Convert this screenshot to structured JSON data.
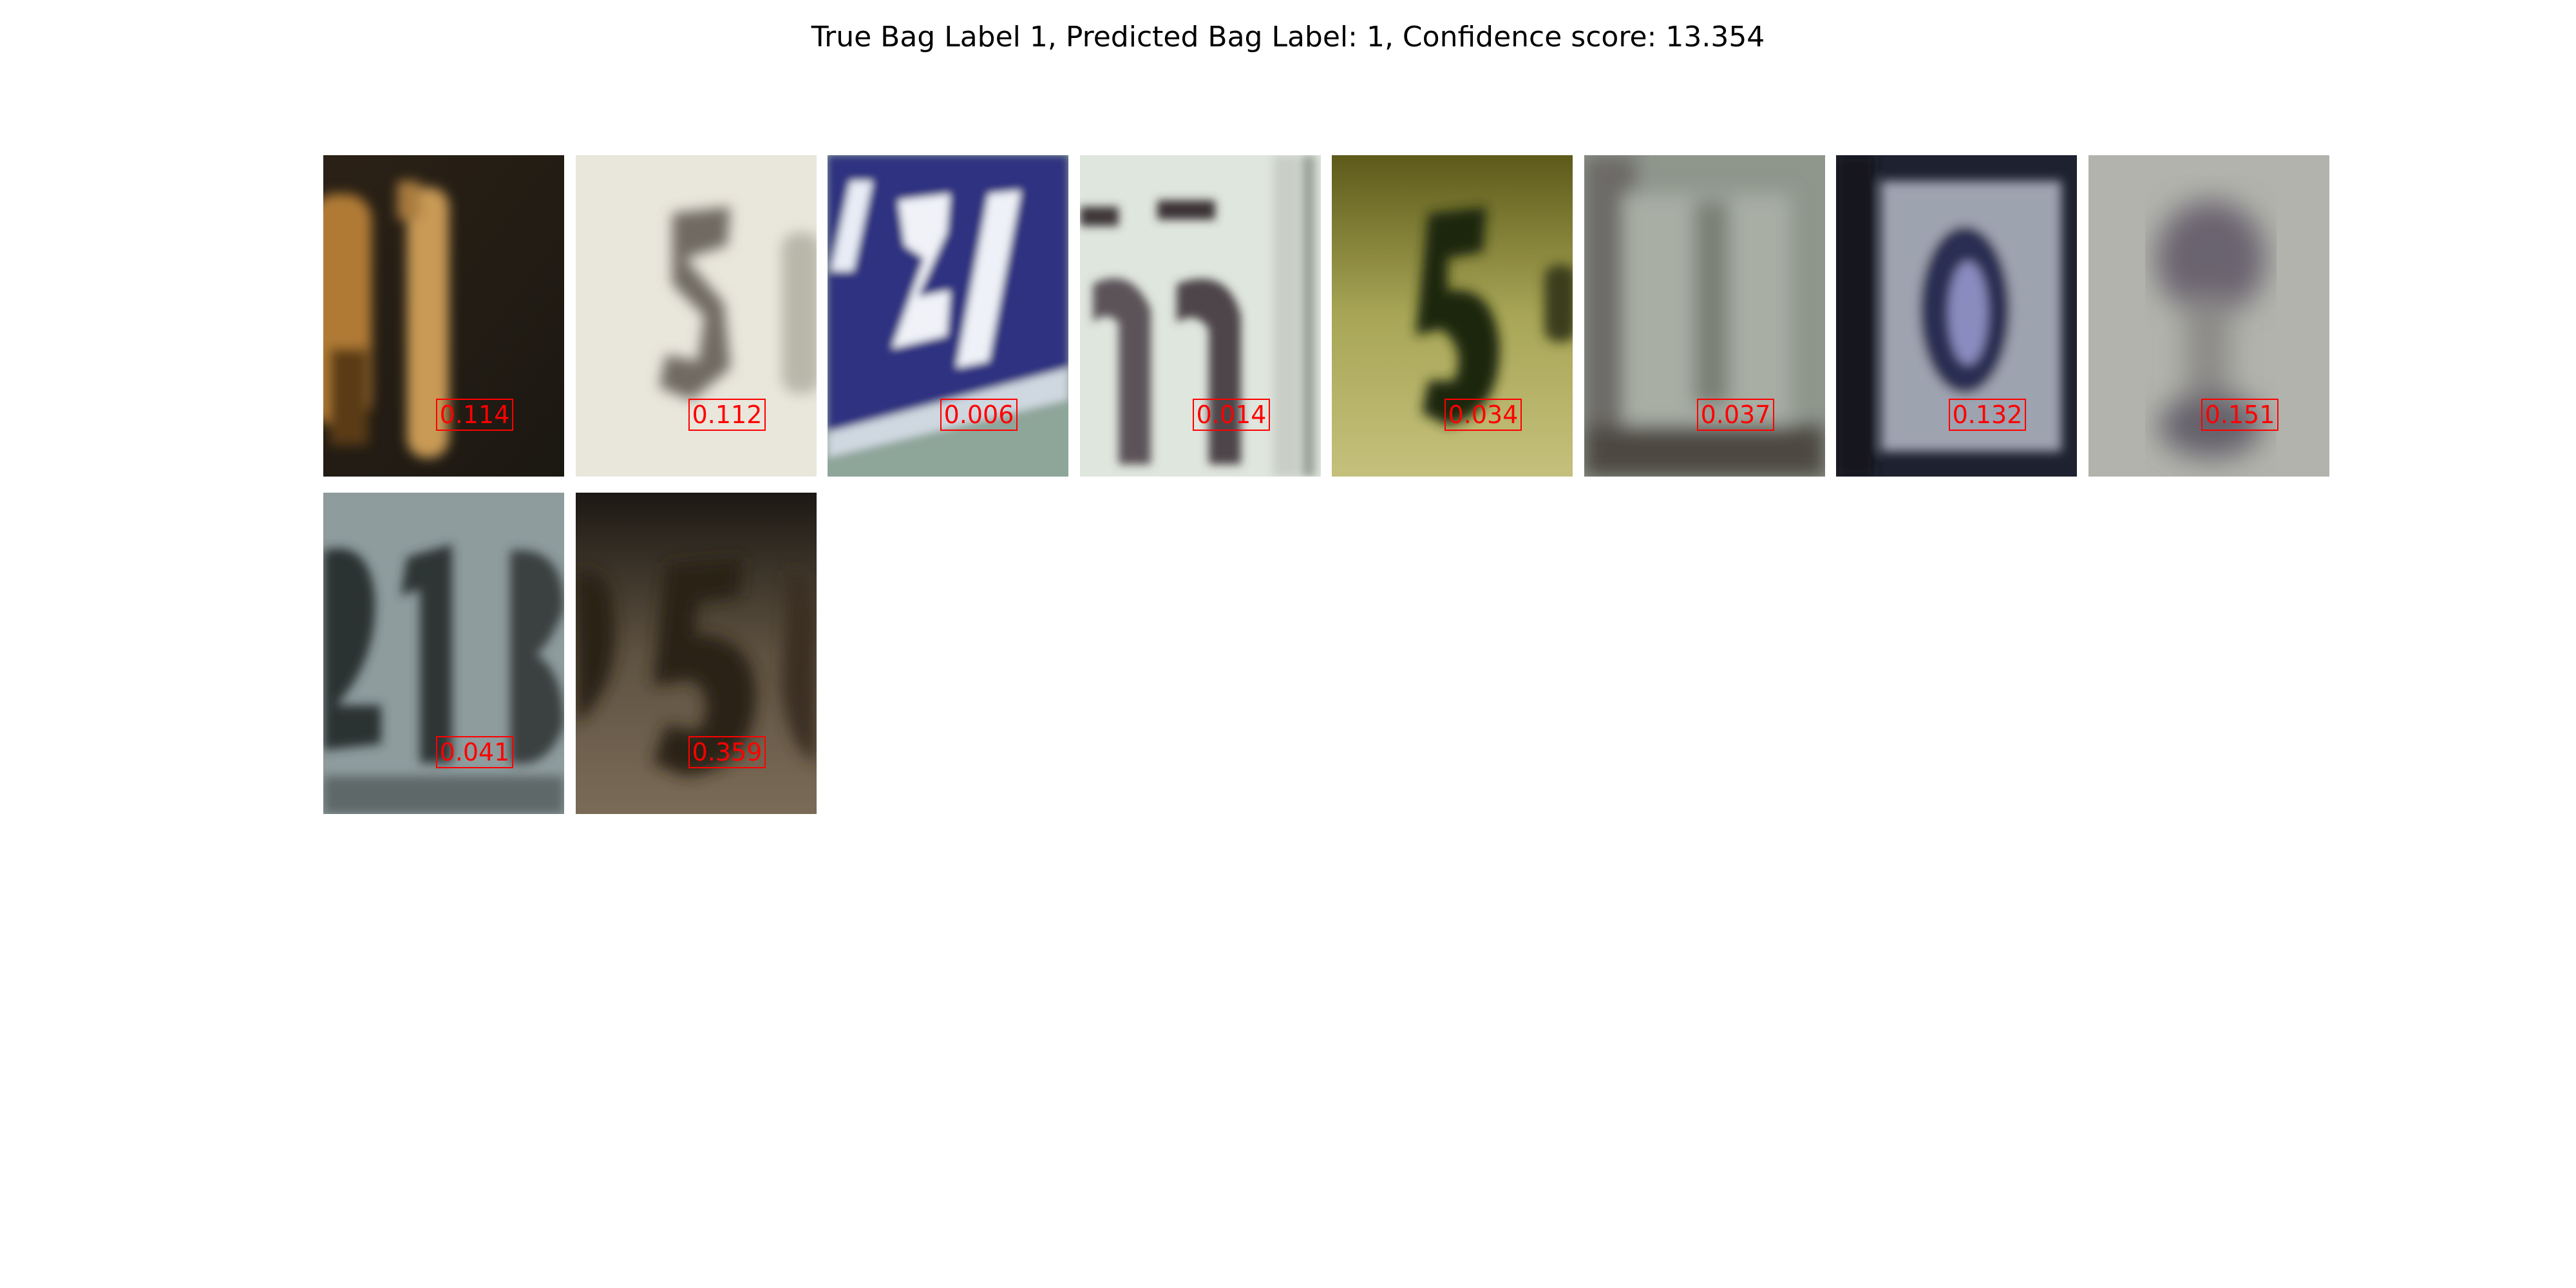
{
  "title": "True Bag Label 1, Predicted Bag Label: 1, Confidence score: 13.354",
  "instances": [
    {
      "score": "0.114",
      "accent": "#c08a3a"
    },
    {
      "score": "0.112",
      "accent": "#6e6a62"
    },
    {
      "score": "0.006",
      "accent": "#2e2f7a"
    },
    {
      "score": "0.014",
      "accent": "#4a4448"
    },
    {
      "score": "0.034",
      "accent": "#1e2a10"
    },
    {
      "score": "0.037",
      "accent": "#7b8077"
    },
    {
      "score": "0.132",
      "accent": "#22253a"
    },
    {
      "score": "0.151",
      "accent": "#6a6570"
    },
    {
      "score": "0.041",
      "accent": "#2f3535"
    },
    {
      "score": "0.359",
      "accent": "#2a2119"
    }
  ],
  "colors": {
    "score_text": "#ff0000",
    "score_box": "#ff0000"
  }
}
